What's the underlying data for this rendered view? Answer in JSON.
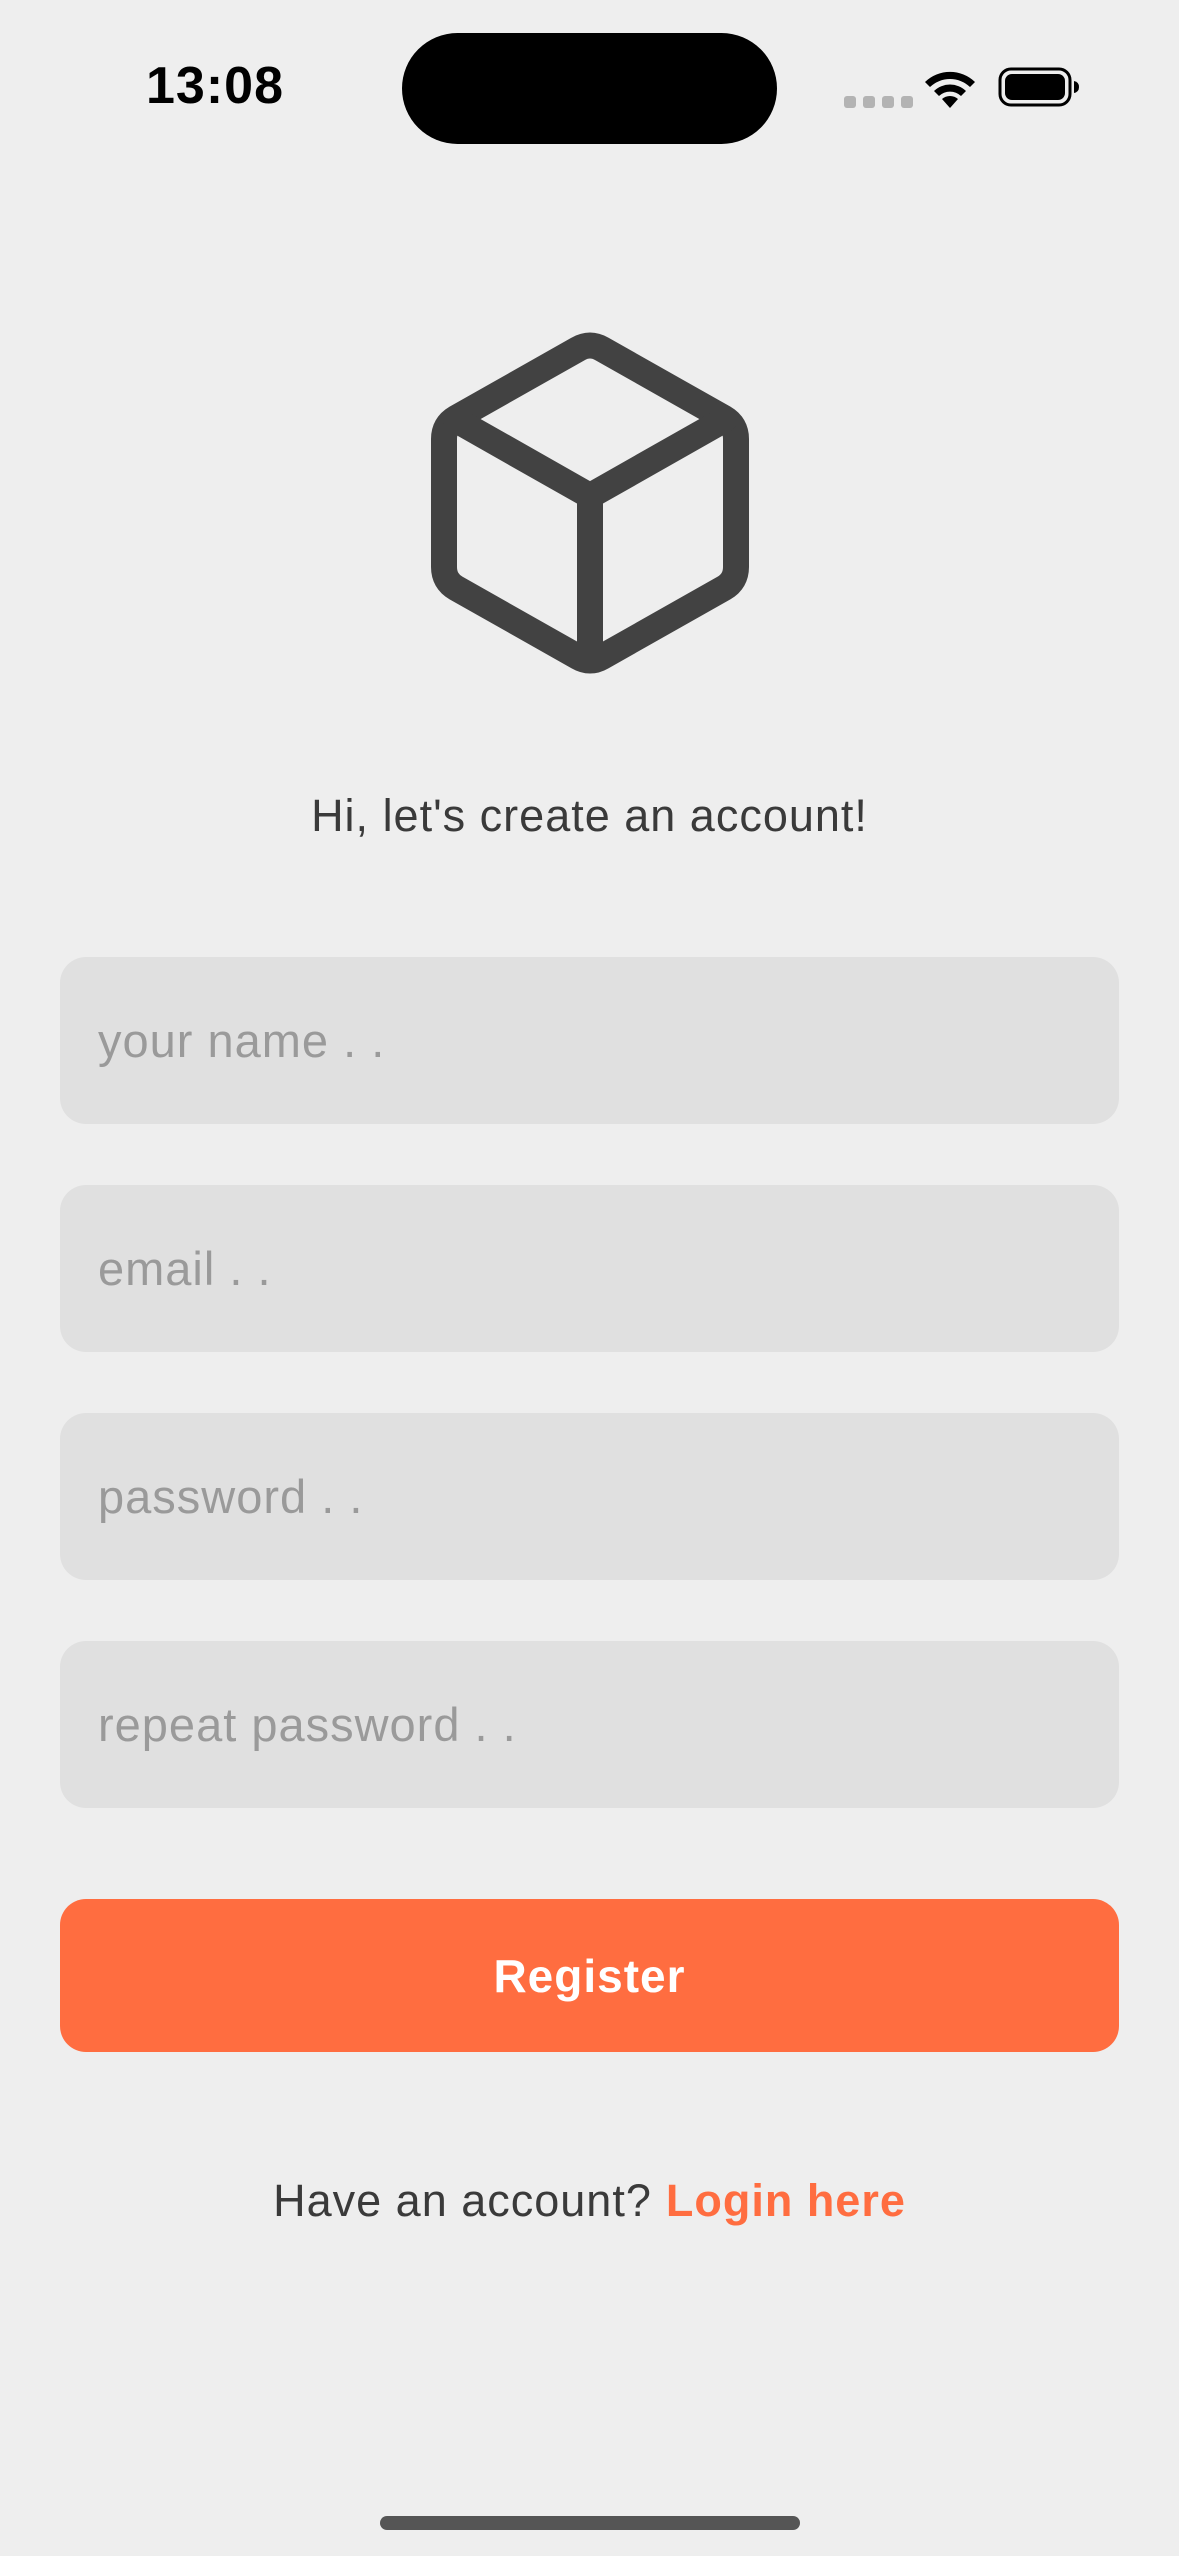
{
  "status_bar": {
    "time": "13:08",
    "icons": [
      "signal-icon",
      "wifi-icon",
      "battery-icon"
    ]
  },
  "logo": {
    "icon": "cube-icon",
    "color": "#424242"
  },
  "greeting": "Hi, let's create an account!",
  "form": {
    "name": {
      "placeholder": "your name . .",
      "value": ""
    },
    "email": {
      "placeholder": "email . .",
      "value": ""
    },
    "password": {
      "placeholder": "password . .",
      "value": ""
    },
    "repeat_password": {
      "placeholder": "repeat password . .",
      "value": ""
    }
  },
  "register_button": {
    "label": "Register",
    "color": "#ff6d40"
  },
  "footer": {
    "prompt": "Have an account?",
    "link_label": "Login here",
    "link_color": "#ff6d40"
  }
}
